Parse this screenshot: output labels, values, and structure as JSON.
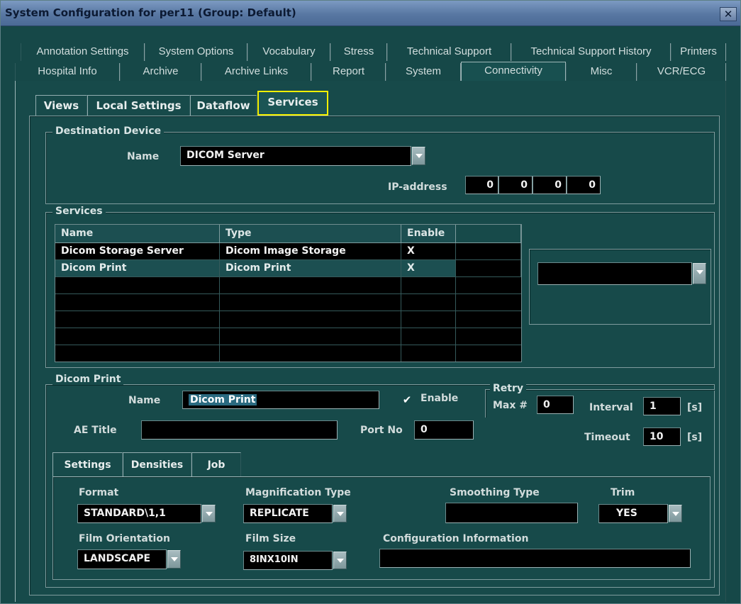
{
  "window": {
    "title": "System Configuration for per11 (Group: Default)",
    "close_glyph": "✕"
  },
  "top_tabs_row1": [
    "Annotation Settings",
    "System Options",
    "Vocabulary",
    "Stress",
    "Technical Support",
    "Technical Support History",
    "Printers"
  ],
  "top_tabs_row2": [
    "Hospital Info",
    "Archive",
    "Archive Links",
    "Report",
    "System",
    "Connectivity",
    "Misc",
    "VCR/ECG"
  ],
  "top_tabs_selected": "Connectivity",
  "sub_tabs": [
    "Views",
    "Local Settings",
    "Dataflow",
    "Services"
  ],
  "sub_tabs_selected": "Services",
  "destination": {
    "legend": "Destination Device",
    "name_label": "Name",
    "name_value": "DICOM Server",
    "ip_label": "IP-address",
    "ip": [
      "0",
      "0",
      "0",
      "0"
    ]
  },
  "services": {
    "legend": "Services",
    "columns": [
      "Name",
      "Type",
      "Enable"
    ],
    "rows": [
      {
        "name": "Dicom Storage Server",
        "type": "Dicom Image Storage",
        "enable": "X"
      },
      {
        "name": "Dicom Print",
        "type": "Dicom Print",
        "enable": "X"
      }
    ],
    "side_select_value": ""
  },
  "dicom_print": {
    "legend": "Dicom Print",
    "name_label": "Name",
    "name_value": "Dicom Print",
    "enable_label": "Enable",
    "enable_checked": true,
    "retry_label": "Retry",
    "maxnum_label": "Max #",
    "maxnum_value": "0",
    "interval_label": "Interval",
    "interval_value": "1",
    "interval_unit": "[s]",
    "ae_title_label": "AE Title",
    "ae_title_value": "",
    "port_label": "Port No",
    "port_value": "0",
    "timeout_label": "Timeout",
    "timeout_value": "10",
    "timeout_unit": "[s]"
  },
  "settings_tabs": [
    "Settings",
    "Densities",
    "Job"
  ],
  "settings_tabs_selected": "Settings",
  "settings": {
    "format_label": "Format",
    "format_value": "STANDARD\\1,1",
    "magnification_label": "Magnification Type",
    "magnification_value": "REPLICATE",
    "smoothing_label": "Smoothing Type",
    "smoothing_value": "",
    "trim_label": "Trim",
    "trim_value": "YES",
    "orientation_label": "Film Orientation",
    "orientation_value": "LANDSCAPE",
    "filmsize_label": "Film Size",
    "filmsize_value": "8INX10IN",
    "config_label": "Configuration Information",
    "config_value": ""
  },
  "colors": {
    "highlight": "#f5f000",
    "panel_bg": "#174a4a",
    "field_bg": "#000000",
    "titlebar": "#5877a2"
  }
}
